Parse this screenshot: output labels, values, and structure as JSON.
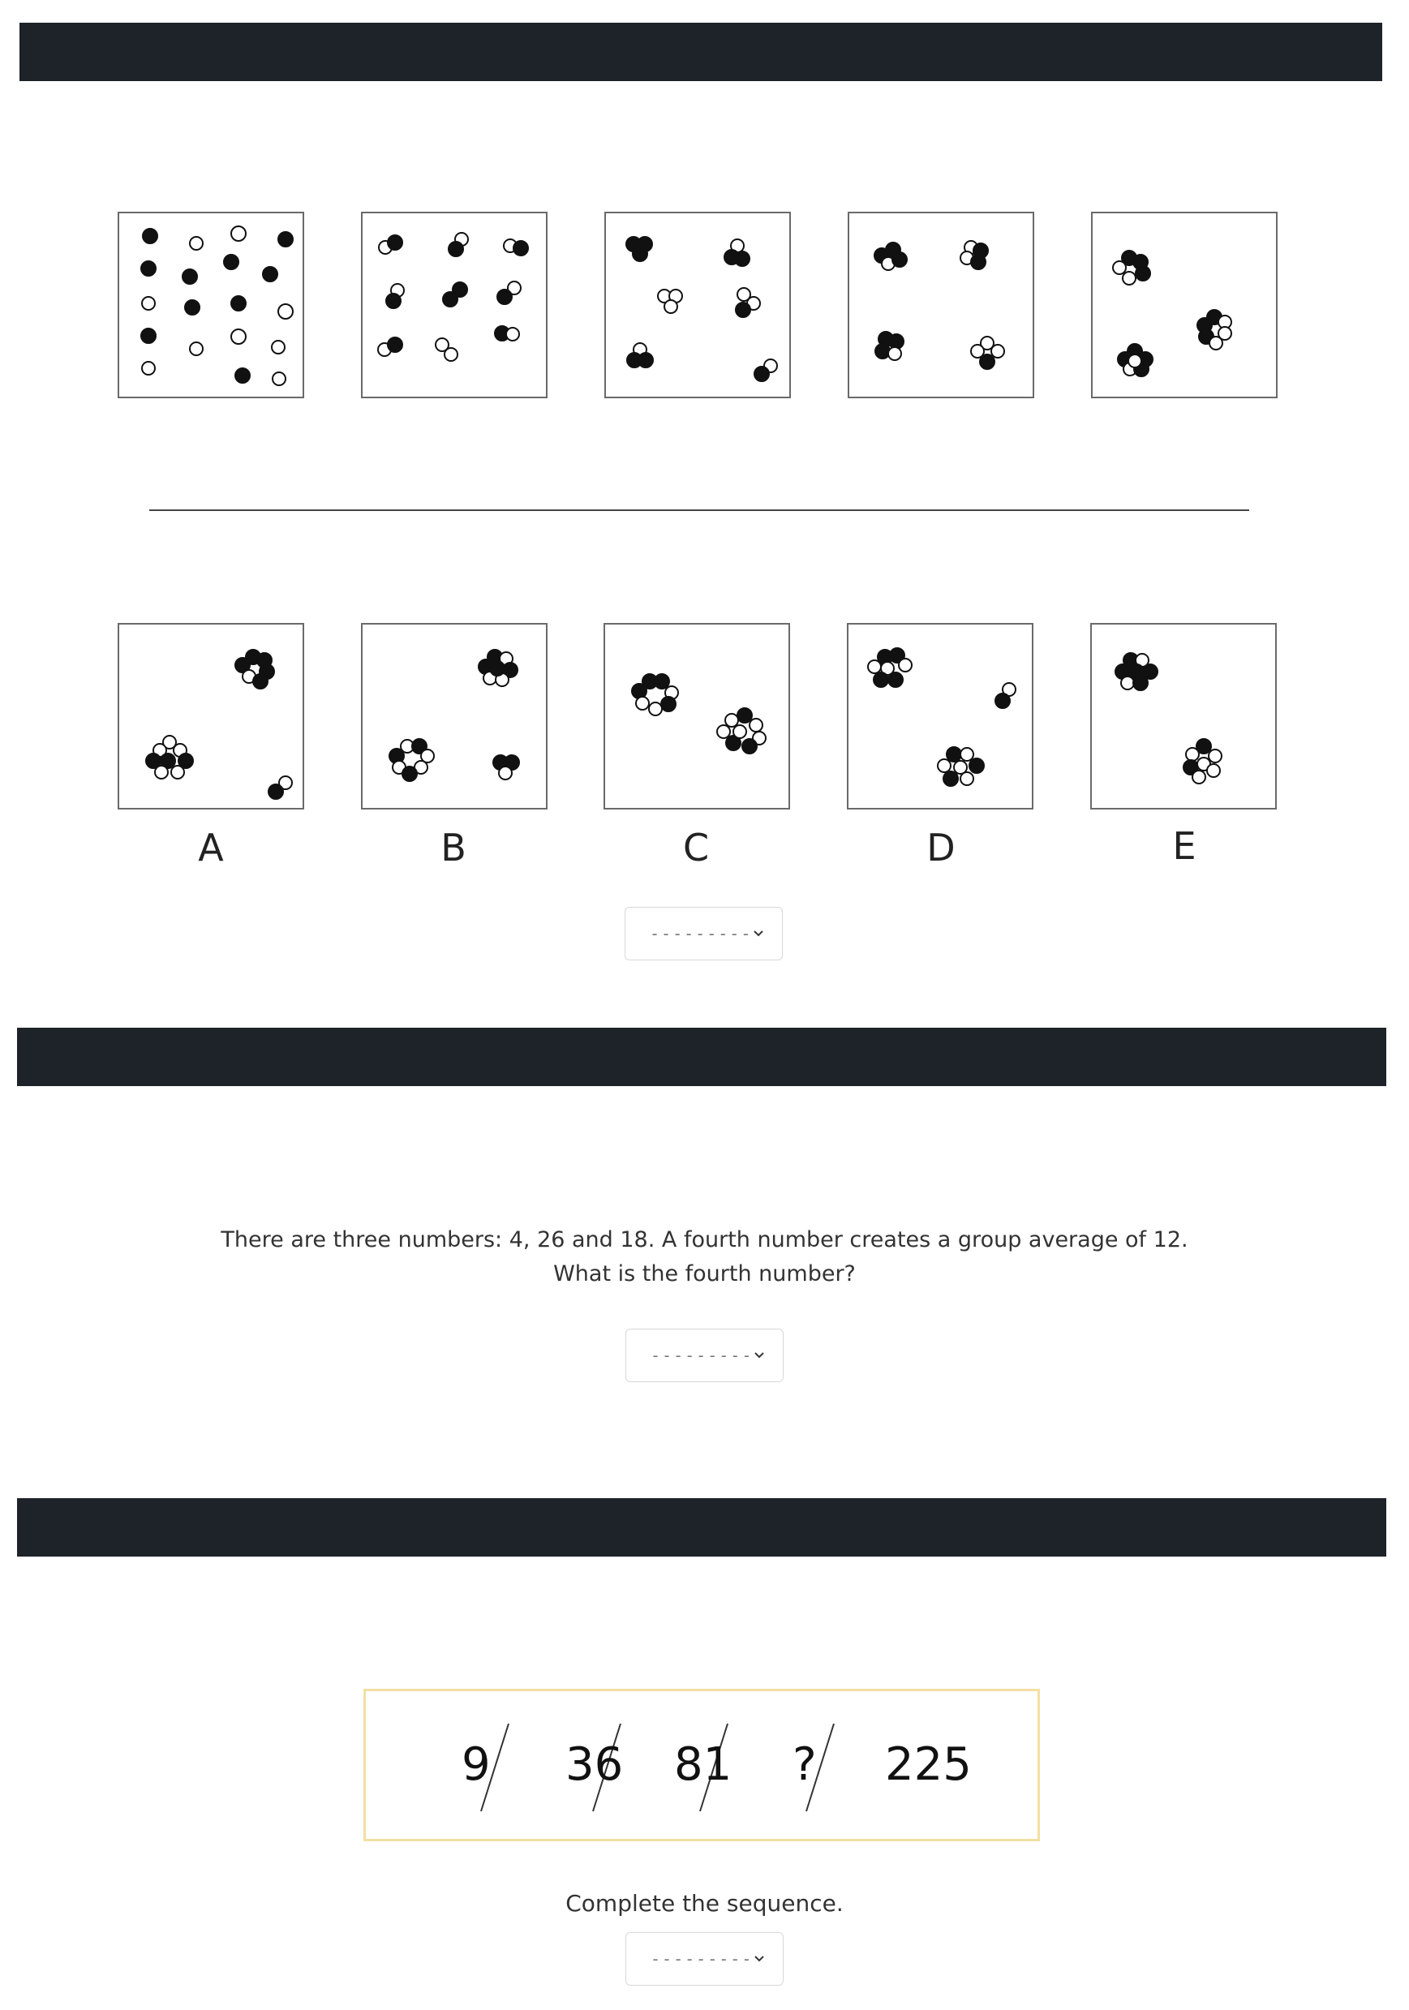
{
  "question1": {
    "sequence_boxes": [
      "box-1",
      "box-2",
      "box-3",
      "box-4",
      "box-5"
    ],
    "options": [
      {
        "letter": "A"
      },
      {
        "letter": "B"
      },
      {
        "letter": "C"
      },
      {
        "letter": "D"
      },
      {
        "letter": "E"
      }
    ],
    "select": {
      "value": "---------"
    }
  },
  "question2": {
    "text": "There are three numbers: 4, 26 and 18. A fourth number creates a group average of 12. What is the fourth number?",
    "select": {
      "value": "---------"
    }
  },
  "question3": {
    "sequence": [
      "9",
      "36",
      "81",
      "?",
      "225"
    ],
    "instruction": "Complete the sequence.",
    "select": {
      "value": "---------"
    }
  },
  "colors": {
    "header_bar": "#1e2229",
    "sequence_border": "#f3dfa3"
  }
}
